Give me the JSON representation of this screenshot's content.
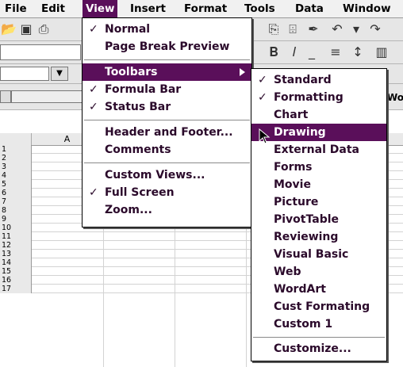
{
  "menubar": {
    "items": [
      "File",
      "Edit",
      "View",
      "Insert",
      "Format",
      "Tools",
      "Data",
      "Window"
    ]
  },
  "sheet": {
    "columns": [
      "A"
    ],
    "cutoff_text": "Wo",
    "rows": [
      "1",
      "2",
      "3",
      "4",
      "5",
      "6",
      "7",
      "8",
      "9",
      "10",
      "11",
      "12",
      "13",
      "14",
      "15",
      "16",
      "17"
    ]
  },
  "view_menu": {
    "normal": "Normal",
    "page_break_preview": "Page Break Preview",
    "toolbars": "Toolbars",
    "formula_bar": "Formula Bar",
    "status_bar": "Status Bar",
    "header_footer": "Header and Footer...",
    "comments": "Comments",
    "custom_views": "Custom Views...",
    "full_screen": "Full Screen",
    "zoom": "Zoom..."
  },
  "toolbars_menu": {
    "items": [
      "Standard",
      "Formatting",
      "Chart",
      "Drawing",
      "External Data",
      "Forms",
      "Movie",
      "Picture",
      "PivotTable",
      "Reviewing",
      "Visual Basic",
      "Web",
      "WordArt",
      "Cust Formating",
      "Custom 1"
    ],
    "customize": "Customize..."
  },
  "colors": {
    "highlight": "#5a0f5a",
    "menu_text": "#2b0a2b"
  }
}
